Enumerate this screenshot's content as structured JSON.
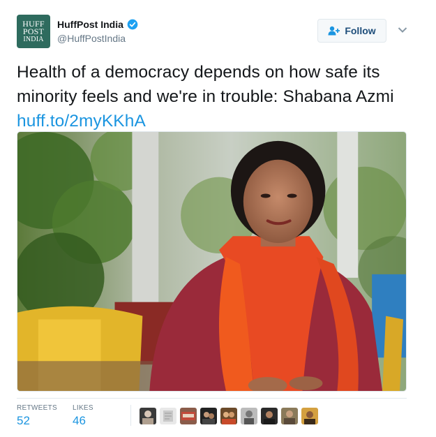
{
  "author": {
    "avatar_text_lines": [
      "HUFF",
      "POST",
      "INDIA"
    ],
    "display_name": "HuffPost India",
    "handle": "@HuffPostIndia",
    "verified": true
  },
  "actions": {
    "follow_label": "Follow"
  },
  "tweet": {
    "text": "Health of a democracy depends on how safe its minority feels and we're in trouble: Shabana Azmi ",
    "link_text": "huff.to/2myKKhA"
  },
  "stats": {
    "retweets_label": "RETWEETS",
    "retweets_count": "52",
    "likes_label": "LIKES",
    "likes_count": "46"
  },
  "colors": {
    "link": "#1b95e0",
    "verified_badge": "#1da1f2",
    "follow_text": "#1d4d7a",
    "avatar_bg": "#2e6b5e"
  },
  "icons": {
    "verified": "verified-badge-icon",
    "follow": "add-user-icon",
    "more": "chevron-down-icon"
  },
  "likers_count_shown": 9
}
